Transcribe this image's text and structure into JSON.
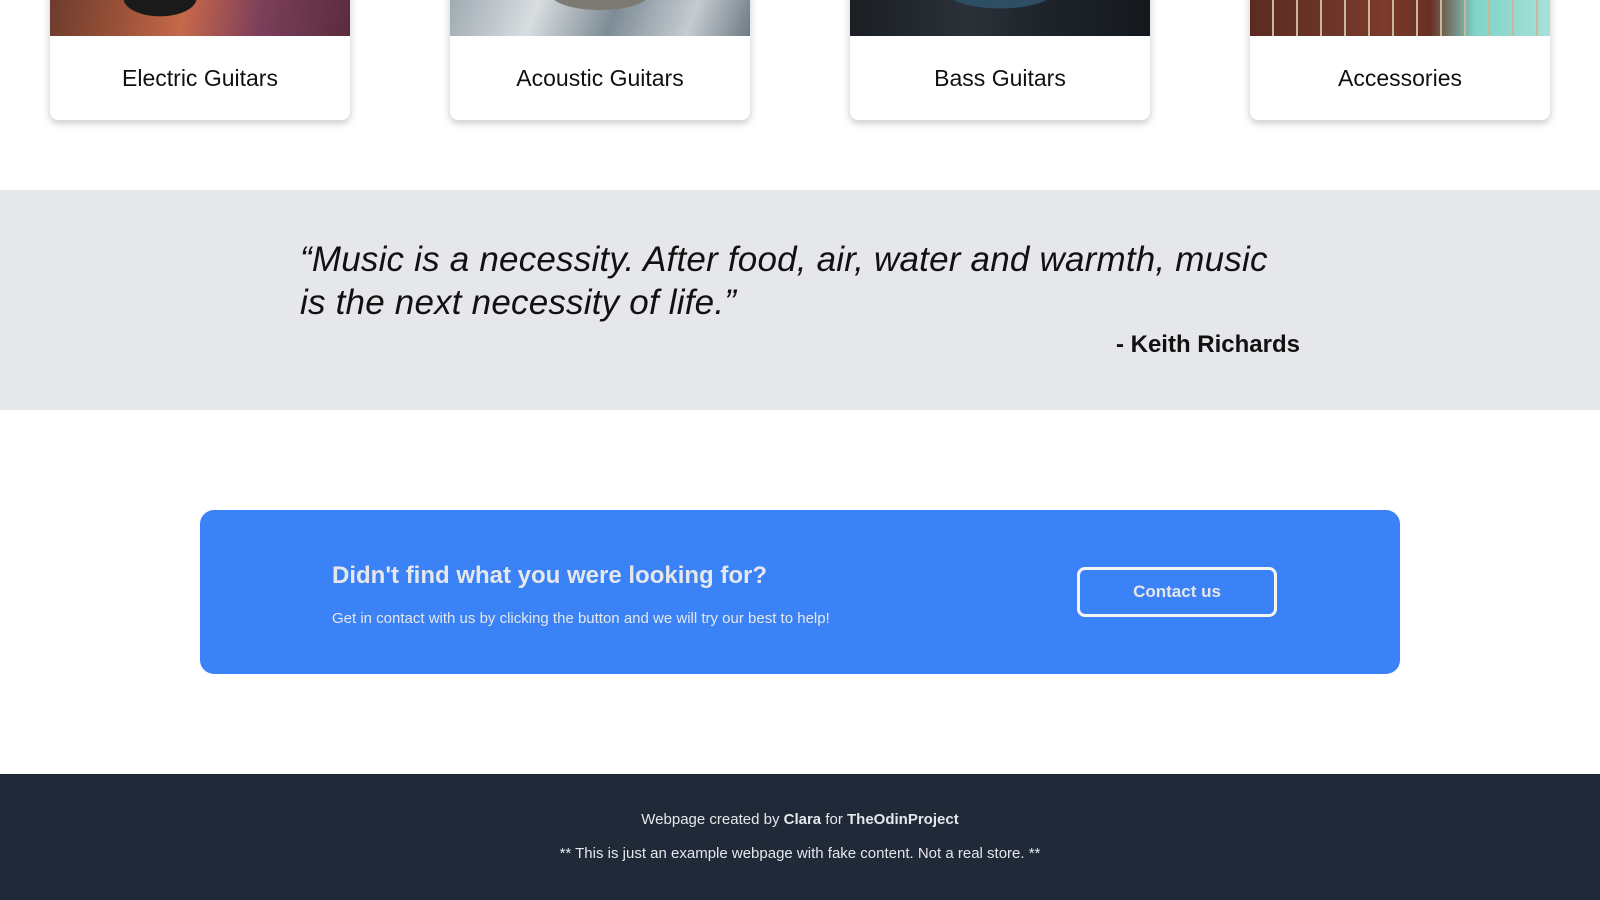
{
  "categories": [
    {
      "label": "Electric Guitars"
    },
    {
      "label": "Acoustic Guitars"
    },
    {
      "label": "Bass Guitars"
    },
    {
      "label": "Accessories"
    }
  ],
  "quote": {
    "text": "“Music is a necessity. After food, air, water and warmth, music is the next necessity of life.”",
    "author": "- Keith Richards"
  },
  "cta": {
    "title": "Didn't find what you were looking for?",
    "description": "Get in contact with us by clicking the button and we will try our best to help!",
    "button_label": "Contact us"
  },
  "footer": {
    "created_prefix": "Webpage created by",
    "author": "Clara",
    "for_word": "for",
    "project": "TheOdinProject",
    "disclaimer": "** This is just an example webpage with fake content. Not a real store. **"
  },
  "colors": {
    "quote_bg": "#e5e7eb",
    "cta_bg": "#3b82f6",
    "footer_bg": "#1f2937",
    "light_text": "#e5e7eb"
  }
}
